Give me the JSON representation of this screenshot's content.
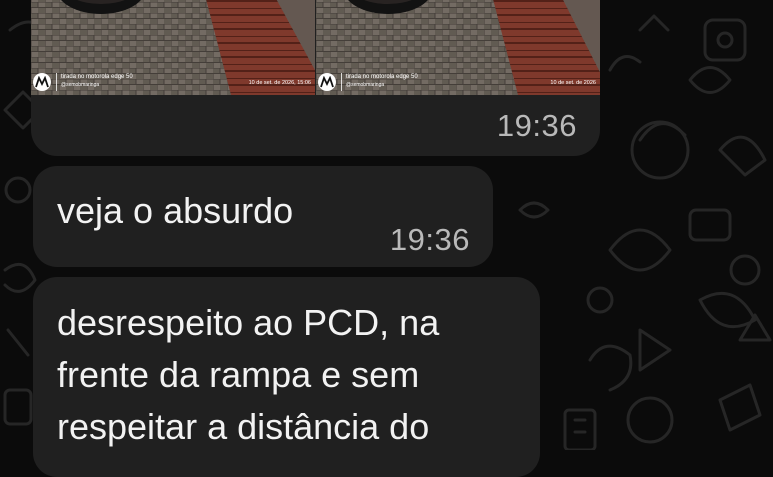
{
  "chat": {
    "messages": [
      {
        "type": "images",
        "time": "19:36",
        "photos": [
          {
            "watermark_line1": "tirada no motorola edge 50",
            "watermark_line2": "@semobmaringa",
            "watermark_date": "10 de set. de 2026, 15:06"
          },
          {
            "watermark_line1": "tirada no motorola edge 50",
            "watermark_line2": "@semobmaringa",
            "watermark_date": "10 de set. de 2026"
          }
        ]
      },
      {
        "type": "text",
        "text": "veja o absurdo",
        "time": "19:36"
      },
      {
        "type": "text",
        "lines": [
          "desrespeito ao PCD, na",
          "frente da rampa e sem",
          "respeitar a distância do"
        ]
      }
    ]
  },
  "colors": {
    "background": "#0b0b0b",
    "bubble": "#202020",
    "text": "#f2f2f2",
    "timestamp": "#b9b9b9"
  },
  "icons": [
    "motorola-logo-icon",
    "wallpaper-doodle-pattern"
  ]
}
